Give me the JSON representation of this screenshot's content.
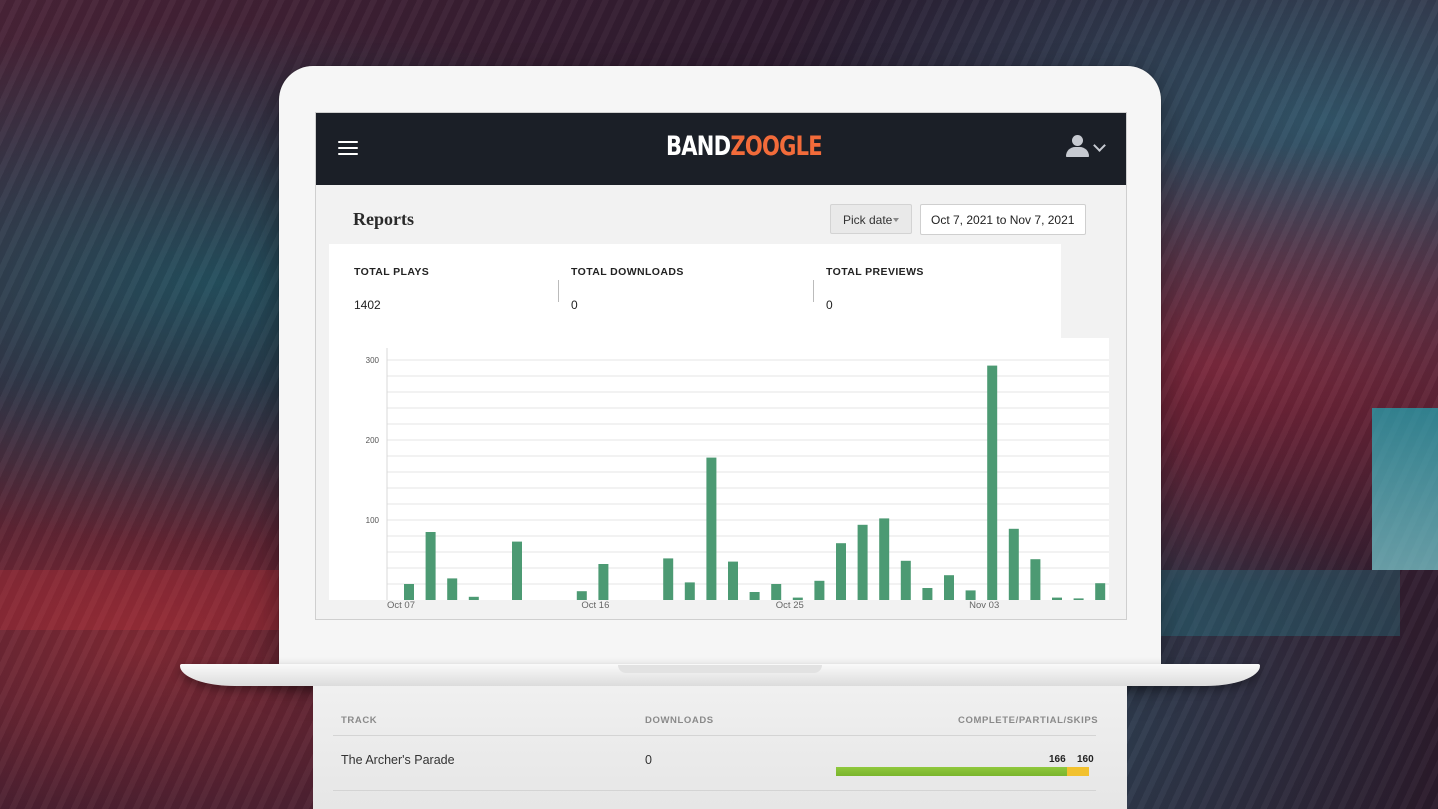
{
  "app": {
    "logo_part1": "BAND",
    "logo_part2": "ZOOGLE",
    "logo_color_primary": "#ffffff",
    "logo_color_accent": "#f26b3a"
  },
  "header": {
    "menu_icon": "hamburger-icon",
    "user_icon": "user-icon",
    "user_chevron_icon": "chevron-down-icon"
  },
  "page": {
    "title": "Reports",
    "pick_date_label": "Pick date",
    "date_range": "Oct 7, 2021 to Nov 7, 2021"
  },
  "stats": [
    {
      "label": "TOTAL PLAYS",
      "value": "1402"
    },
    {
      "label": "TOTAL DOWNLOADS",
      "value": "0"
    },
    {
      "label": "TOTAL PREVIEWS",
      "value": "0"
    }
  ],
  "chart_data": {
    "type": "bar",
    "title": "",
    "xlabel": "",
    "ylabel": "",
    "ylim": [
      0,
      315
    ],
    "yticks": [
      100,
      200,
      300
    ],
    "xtick_labels": [
      {
        "index": 0,
        "label": "Oct 07"
      },
      {
        "index": 9,
        "label": "Oct 16"
      },
      {
        "index": 18,
        "label": "Oct 25"
      },
      {
        "index": 27,
        "label": "Nov 03"
      }
    ],
    "values": [
      20,
      85,
      27,
      4,
      0,
      73,
      0,
      0,
      11,
      45,
      0,
      0,
      52,
      22,
      178,
      48,
      10,
      20,
      3,
      24,
      71,
      94,
      102,
      49,
      15,
      31,
      12,
      293,
      89,
      51,
      3,
      2,
      21
    ],
    "bar_color": "#4c9a73",
    "grid": true
  },
  "tracks_table": {
    "headers": {
      "track": "TRACK",
      "downloads": "DOWNLOADS",
      "complete": "COMPLETE/PARTIAL/SKIPS"
    },
    "rows": [
      {
        "track": "The Archer's Parade",
        "downloads": "0",
        "complete": 166,
        "partial": 160,
        "complete_label": "166",
        "partial_label": "160",
        "complete_fraction": 0.913,
        "partial_fraction": 0.087
      }
    ]
  }
}
